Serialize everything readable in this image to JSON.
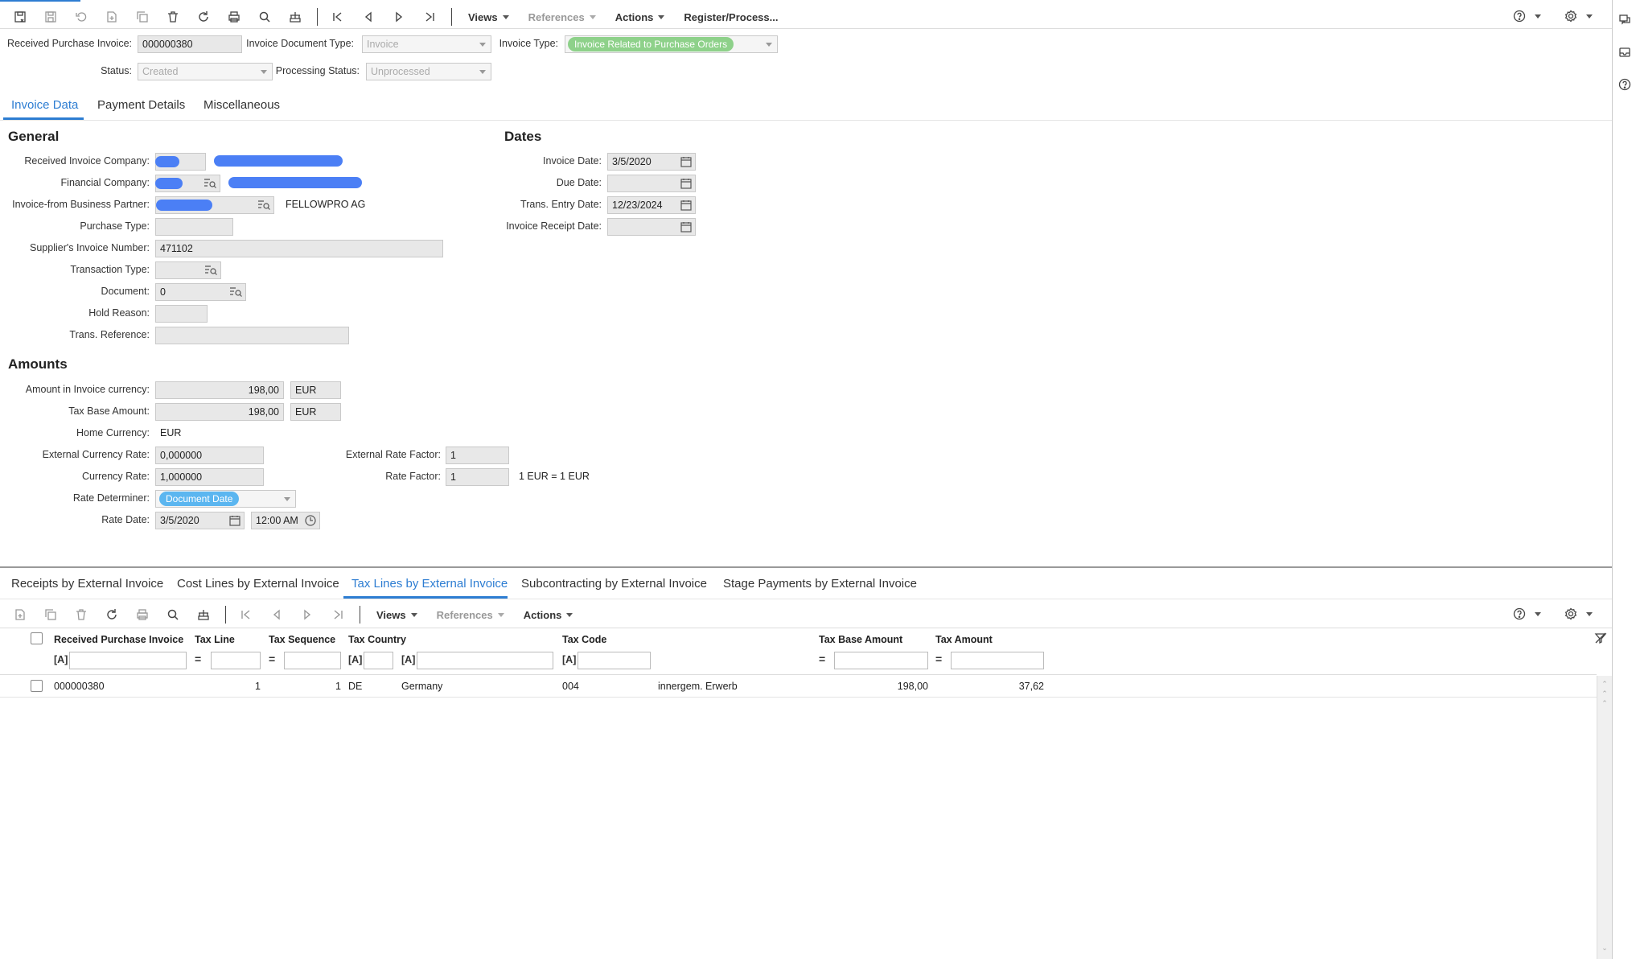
{
  "toolbar": {
    "views": "Views",
    "references": "References",
    "actions": "Actions",
    "register": "Register/Process..."
  },
  "header": {
    "received_purchase_invoice_label": "Received Purchase Invoice:",
    "received_purchase_invoice_value": "000000380",
    "invoice_document_type_label": "Invoice Document Type:",
    "invoice_document_type_value": "Invoice",
    "invoice_type_label": "Invoice Type:",
    "invoice_type_value": "Invoice Related to Purchase Orders",
    "status_label": "Status:",
    "status_value": "Created",
    "processing_status_label": "Processing Status:",
    "processing_status_value": "Unprocessed"
  },
  "tabs": [
    "Invoice Data",
    "Payment Details",
    "Miscellaneous"
  ],
  "general": {
    "title": "General",
    "received_invoice_company": "Received Invoice Company:",
    "financial_company": "Financial Company:",
    "invoice_from_bp": "Invoice-from Business Partner:",
    "bp_name": "FELLOWPRO AG",
    "purchase_type": "Purchase Type:",
    "supplier_invoice_number": "Supplier's Invoice Number:",
    "supplier_invoice_number_value": "471102",
    "transaction_type": "Transaction Type:",
    "document": "Document:",
    "document_value": "0",
    "hold_reason": "Hold Reason:",
    "trans_reference": "Trans. Reference:"
  },
  "dates": {
    "title": "Dates",
    "invoice_date": "Invoice Date:",
    "invoice_date_value": "3/5/2020",
    "due_date": "Due Date:",
    "trans_entry_date": "Trans. Entry Date:",
    "trans_entry_date_value": "12/23/2024",
    "invoice_receipt_date": "Invoice Receipt Date:"
  },
  "amounts": {
    "title": "Amounts",
    "amount_invoice_currency": "Amount in Invoice currency:",
    "amount_invoice_currency_value": "198,00",
    "amount_currency": "EUR",
    "tax_base_amount": "Tax Base Amount:",
    "tax_base_amount_value": "198,00",
    "tax_base_currency": "EUR",
    "home_currency": "Home Currency:",
    "home_currency_value": "EUR",
    "external_currency_rate": "External Currency Rate:",
    "external_currency_rate_value": "0,000000",
    "external_rate_factor": "External Rate Factor:",
    "external_rate_factor_value": "1",
    "currency_rate": "Currency Rate:",
    "currency_rate_value": "1,000000",
    "rate_factor": "Rate Factor:",
    "rate_factor_value": "1",
    "rate_text": "1 EUR = 1 EUR",
    "rate_determiner": "Rate Determiner:",
    "rate_determiner_value": "Document Date",
    "rate_date": "Rate Date:",
    "rate_date_value": "3/5/2020",
    "rate_time_value": "12:00 AM"
  },
  "bottom_tabs": [
    "Receipts by External Invoice",
    "Cost Lines by External Invoice",
    "Tax Lines by External Invoice",
    "Subcontracting by External Invoice",
    "Stage Payments by External Invoice"
  ],
  "grid": {
    "views": "Views",
    "references": "References",
    "actions": "Actions",
    "columns": [
      "Received Purchase Invoice",
      "Tax Line",
      "Tax Sequence",
      "Tax Country",
      "Tax Code",
      "Tax Base Amount",
      "Tax Amount"
    ],
    "text_op": "[A]",
    "eq_op": "=",
    "row": {
      "invoice": "000000380",
      "tax_line": "1",
      "tax_sequence": "1",
      "country_code": "DE",
      "country_name": "Germany",
      "tax_code": "004",
      "tax_code_desc": "innergem. Erwerb",
      "tax_base_amount": "198,00",
      "tax_amount": "37,62"
    }
  },
  "colors": {
    "accent": "#2d7dd2",
    "invoice_type_chip": "#8ed18a",
    "rate_chip": "#5bb6f0",
    "redaction": "#4b7ff5"
  }
}
